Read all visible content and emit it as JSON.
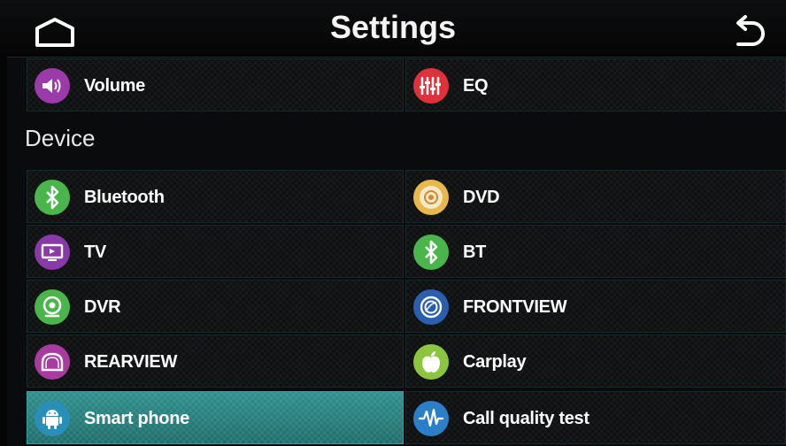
{
  "header": {
    "title": "Settings"
  },
  "section": {
    "device_title": "Device"
  },
  "top_items": [
    {
      "label": "Volume",
      "icon": "speaker-icon",
      "color": "#9b3aa8"
    },
    {
      "label": "EQ",
      "icon": "equalizer-icon",
      "color": "#e0303a"
    }
  ],
  "device_items": [
    {
      "label": "Bluetooth",
      "icon": "bluetooth-icon",
      "color": "#4ab54a"
    },
    {
      "label": "DVD",
      "icon": "disc-icon",
      "color": "#e8b84a"
    },
    {
      "label": "TV",
      "icon": "tv-icon",
      "color": "#8a3aa8"
    },
    {
      "label": "BT",
      "icon": "bluetooth-icon",
      "color": "#4ab54a"
    },
    {
      "label": "DVR",
      "icon": "camera-icon",
      "color": "#4ab54a"
    },
    {
      "label": "FRONTVIEW",
      "icon": "lens-icon",
      "color": "#2a5fb0"
    },
    {
      "label": "REARVIEW",
      "icon": "rearview-icon",
      "color": "#a83aa0"
    },
    {
      "label": "Carplay",
      "icon": "apple-icon",
      "color": "#8cc63f"
    },
    {
      "label": "Smart phone",
      "icon": "android-icon",
      "color": "#2a8fb8",
      "active": true
    },
    {
      "label": "Call quality test",
      "icon": "waveform-icon",
      "color": "#2a7fc8"
    }
  ]
}
